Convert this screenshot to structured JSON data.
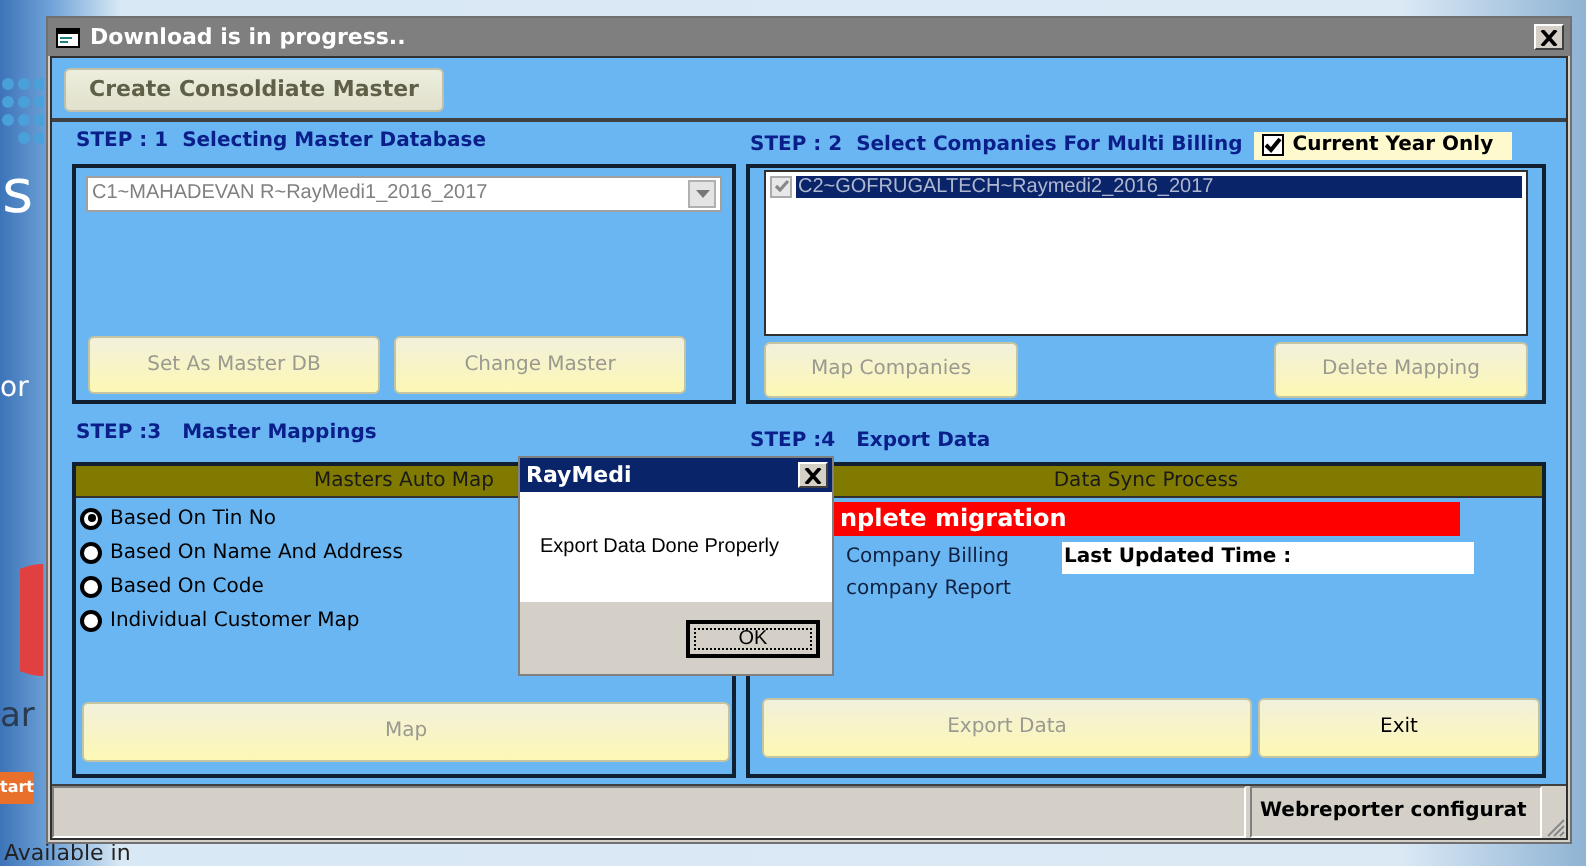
{
  "background_page": {
    "headline_1": "s",
    "tagline": "or",
    "heading": "ar",
    "start_button": "tart",
    "caption": "Available in"
  },
  "window": {
    "title": "Download is in progress.."
  },
  "create_button": {
    "label": "Create Consoldiate Master",
    "disabled": false
  },
  "step1": {
    "label": "STEP : 1  Selecting Master Database",
    "combo": {
      "value": "C1~MAHADEVAN R~RayMedi1_2016_2017"
    },
    "buttons": [
      {
        "label": "Set As Master DB",
        "disabled": true
      },
      {
        "label": "Change Master",
        "disabled": true
      }
    ]
  },
  "step2": {
    "label": "STEP : 2  Select Companies For Multi Billing",
    "current_year_only": {
      "label": "Current Year Only",
      "checked": true
    },
    "companies": [
      {
        "label": "C2~GOFRUGALTECH~Raymedi2_2016_2017",
        "checked": true,
        "selected": true
      }
    ],
    "buttons": [
      {
        "label": "Map Companies",
        "disabled": true
      },
      {
        "label": "Delete Mapping",
        "disabled": true
      }
    ]
  },
  "step3": {
    "label": "STEP :3   Master Mappings",
    "header": "Masters Auto Map",
    "options": [
      {
        "label": "Based On Tin No",
        "selected": true
      },
      {
        "label": "Based On Name And Address",
        "selected": false
      },
      {
        "label": "Based On Code",
        "selected": false
      },
      {
        "label": "Individual Customer Map",
        "selected": false
      }
    ],
    "button": {
      "label": "Map",
      "disabled": true
    }
  },
  "step4": {
    "label": "STEP :4   Export Data",
    "header": "Data Sync Process",
    "status": "nplete migration",
    "reports": [
      "Company Billing",
      "company Report"
    ],
    "last_updated": {
      "label": "Last Updated Time :"
    },
    "buttons": [
      {
        "label": "Export Data",
        "disabled": true
      },
      {
        "label": "Exit",
        "disabled": false
      }
    ]
  },
  "status_bar": {
    "panels": [
      "Webreporter configurat"
    ]
  },
  "dialog": {
    "title": "RayMedi",
    "message": "Export Data Done Properly",
    "button": "OK"
  }
}
